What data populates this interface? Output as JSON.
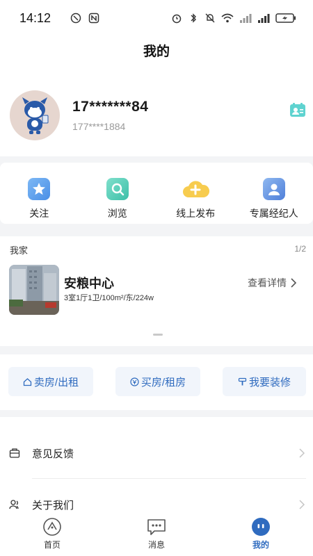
{
  "status_bar": {
    "time": "14:12"
  },
  "header": {
    "title": "我的"
  },
  "profile": {
    "name": "17*******84",
    "phone": "177****1884"
  },
  "quick_actions": [
    {
      "label": "关注",
      "icon": "star-icon"
    },
    {
      "label": "浏览",
      "icon": "search-icon"
    },
    {
      "label": "线上发布",
      "icon": "cloud-plus-icon"
    },
    {
      "label": "专属经纪人",
      "icon": "agent-icon"
    }
  ],
  "my_home": {
    "heading": "我家",
    "page": "1/2",
    "name": "安粮中心",
    "detail": "3室1厅1卫/100m²/东/224w",
    "view_detail": "查看详情"
  },
  "actions": [
    {
      "label": "卖房/出租",
      "icon": "house-icon"
    },
    {
      "label": "买房/租房",
      "icon": "yen-icon"
    },
    {
      "label": "我要装修",
      "icon": "brush-icon"
    }
  ],
  "menu": [
    {
      "label": "意见反馈",
      "icon": "feedback-icon"
    },
    {
      "label": "关于我们",
      "icon": "people-icon"
    }
  ],
  "tabbar": [
    {
      "label": "首页",
      "icon": "home-icon",
      "active": false
    },
    {
      "label": "消息",
      "icon": "message-icon",
      "active": false
    },
    {
      "label": "我的",
      "icon": "profile-icon",
      "active": true
    }
  ],
  "colors": {
    "accent": "#2f6bbf",
    "teal": "#5fd3d0",
    "background": "#f3f4f6"
  }
}
